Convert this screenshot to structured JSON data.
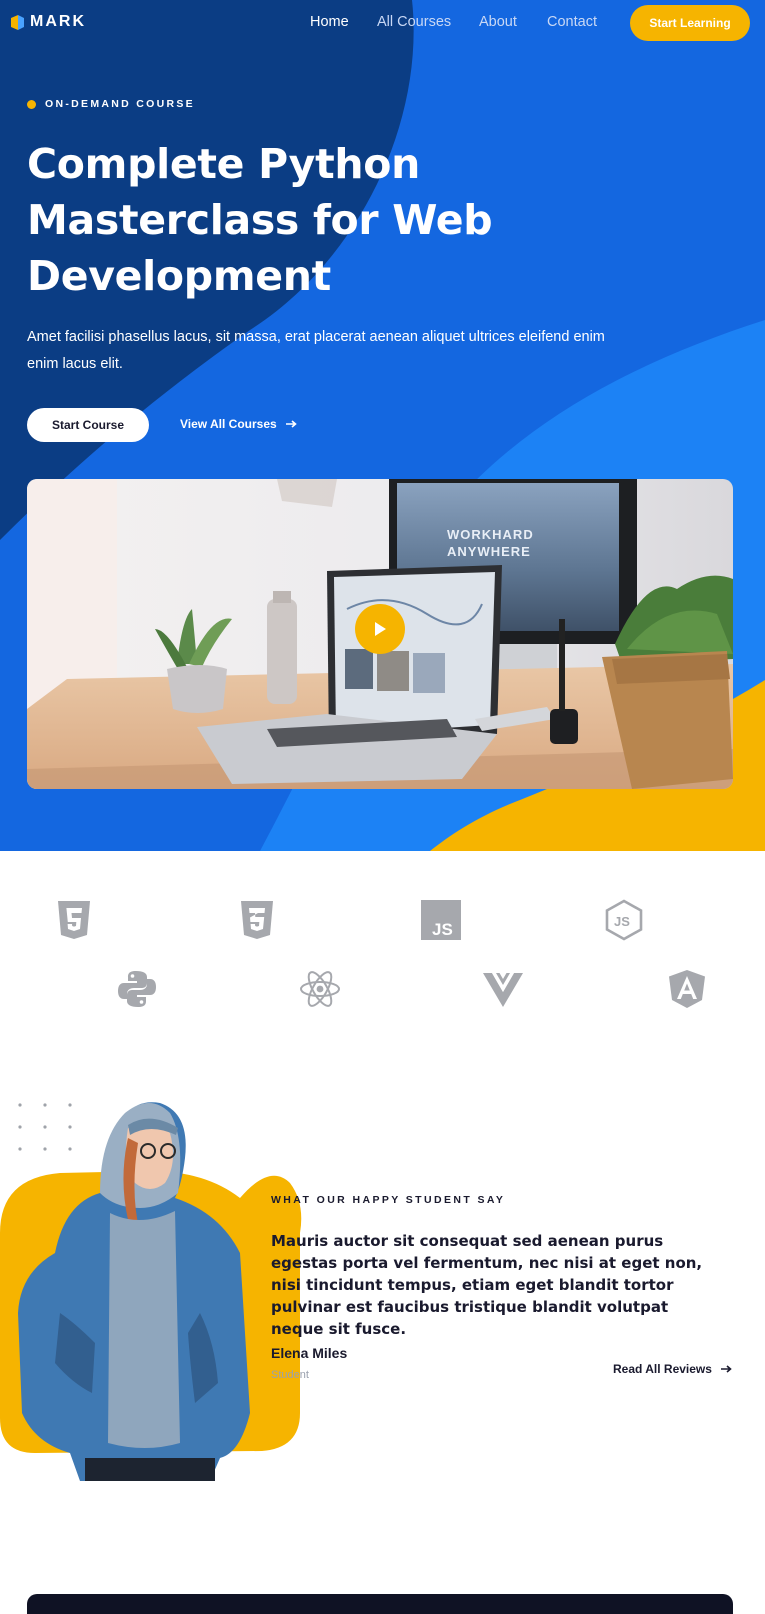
{
  "colors": {
    "primary": "#1467e0",
    "navy": "#0b3d84",
    "accent": "#f6b400",
    "logo_gray": "#a6a8ad"
  },
  "nav": {
    "brand": "MARK",
    "links": [
      "Home",
      "All Courses",
      "About",
      "Contact"
    ],
    "active_link": "Home",
    "cta": "Start Learning"
  },
  "hero": {
    "eyebrow": "ON-DEMAND COURSE",
    "title": "Complete Python Masterclass for Web Development",
    "description": "Amet facilisi phasellus lacus, sit massa, erat placerat aenean aliquet ultrices eleifend enim enim lacus elit.",
    "primary_button": "Start Course",
    "secondary_link": "View All Courses",
    "video_screen_text": [
      "WORKHARD",
      "ANYWHERE"
    ]
  },
  "tech_logos": [
    "html5-icon",
    "css3-icon",
    "javascript-icon",
    "nodejs-icon",
    "python-icon",
    "react-icon",
    "vue-icon",
    "angular-icon"
  ],
  "tech_logo_text": {
    "js": "JS"
  },
  "testimonial": {
    "eyebrow": "WHAT OUR HAPPY STUDENT SAY",
    "quote": "Mauris auctor sit consequat sed aenean purus egestas porta vel fermentum, nec nisi at eget non, nisi tincidunt tempus, etiam eget blandit tortor pulvinar est faucibus tristique blandit volutpat neque sit fusce.",
    "name": "Elena Miles",
    "role": "Student",
    "link": "Read All Reviews"
  }
}
